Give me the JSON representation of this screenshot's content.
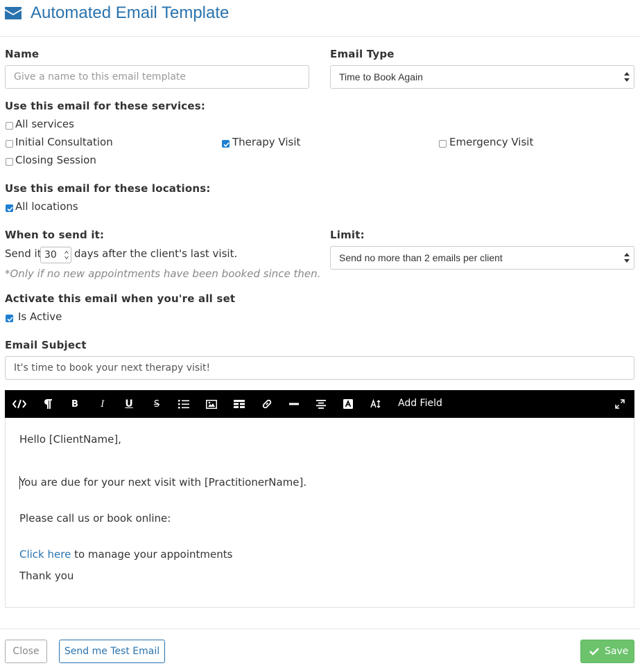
{
  "header": {
    "title": "Automated Email Template",
    "icon": "envelope-icon"
  },
  "name_field": {
    "label": "Name",
    "placeholder": "Give a name to this email template",
    "value": ""
  },
  "email_type": {
    "label": "Email Type",
    "selected": "Time to Book Again"
  },
  "services": {
    "label": "Use this email for these services:",
    "options": [
      {
        "label": "All services",
        "checked": false
      },
      {
        "label": "Initial Consultation",
        "checked": false
      },
      {
        "label": "Therapy Visit",
        "checked": true
      },
      {
        "label": "Emergency Visit",
        "checked": false
      },
      {
        "label": "Closing Session",
        "checked": false
      }
    ]
  },
  "locations": {
    "label": "Use this email for these locations:",
    "options": [
      {
        "label": "All locations",
        "checked": true
      }
    ]
  },
  "schedule": {
    "label": "When to send it:",
    "prefix": "Send it",
    "days": "30",
    "suffix": "days after the client's last visit.",
    "note": "*Only if no new appointments have been booked since then."
  },
  "limit": {
    "label": "Limit:",
    "selected": "Send no more than 2 emails per client"
  },
  "activate": {
    "label": "Activate this email when you're all set",
    "checkbox_label": "Is Active",
    "checked": true
  },
  "subject": {
    "label": "Email Subject",
    "value": "It's time to book your next therapy visit!"
  },
  "editor": {
    "toolbar": {
      "buttons": [
        "code-view",
        "paragraph",
        "bold",
        "italic",
        "underline",
        "strikethrough",
        "bullet-list",
        "image",
        "table",
        "link",
        "horizontal-rule",
        "align",
        "text-color",
        "font-size",
        "fullscreen"
      ],
      "add_field_label": "Add Field"
    },
    "body": {
      "greeting": "Hello [ClientName],",
      "line1": "You are due for your next visit with [PractitionerName].",
      "line2": "Please call us or book online:",
      "link_text": "Click here",
      "link_suffix": " to manage your appointments",
      "signoff": "Thank you"
    }
  },
  "footer": {
    "close_label": "Close",
    "test_label": "Send me Test Email",
    "save_label": "Save"
  },
  "colors": {
    "brand": "#2a73ae",
    "checkbox": "#1e7fd2",
    "save": "#6cc36c",
    "toolbar": "#000000"
  }
}
